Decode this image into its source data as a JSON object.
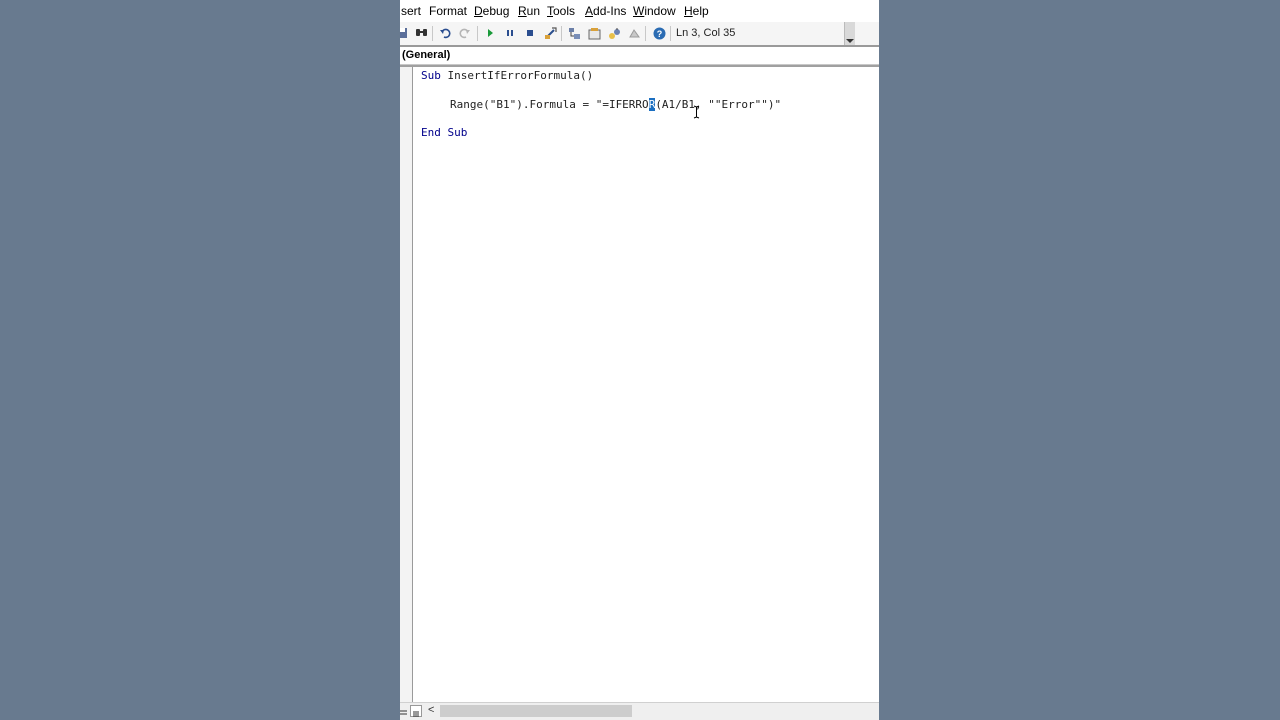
{
  "menubar": {
    "items": [
      {
        "label": "sert",
        "accel": "",
        "rest": "sert"
      },
      {
        "label": "Format",
        "accel": "",
        "rest": "Format"
      },
      {
        "label": "Debug",
        "accel": "D",
        "rest": "ebug"
      },
      {
        "label": "Run",
        "accel": "R",
        "rest": "un"
      },
      {
        "label": "Tools",
        "accel": "T",
        "rest": "ools"
      },
      {
        "label": "Add-Ins",
        "accel": "A",
        "rest": "dd-Ins"
      },
      {
        "label": "Window",
        "accel": "W",
        "rest": "indow"
      },
      {
        "label": "Help",
        "accel": "H",
        "rest": "elp"
      }
    ]
  },
  "toolbar": {
    "icons": [
      "save-icon",
      "find-icon",
      "undo-icon",
      "redo-icon",
      "run-icon",
      "break-icon",
      "reset-icon",
      "design-mode-icon",
      "project-explorer-icon",
      "properties-icon",
      "object-browser-icon",
      "toolbox-icon",
      "help-icon"
    ],
    "position_text": "Ln 3, Col 35",
    "colors": {
      "run": "#1a9a3a",
      "help": "#2b6cb3"
    }
  },
  "object_combo": {
    "value": "(General)"
  },
  "code": {
    "line1_kw": "Sub",
    "line1_rest": " InsertIfErrorFormula()",
    "line2_before": "Range(\"B1\").Formula = \"=IFERRO",
    "line2_selected": "R",
    "line2_after": "(A1/B1, \"\"Error\"\")\"",
    "line3_kw1": "End",
    "line3_kw2": "Sub",
    "keyword_color": "#00008b",
    "selection_color": "#1b6fc1"
  },
  "bottombar": {
    "left_arrow": "<"
  }
}
